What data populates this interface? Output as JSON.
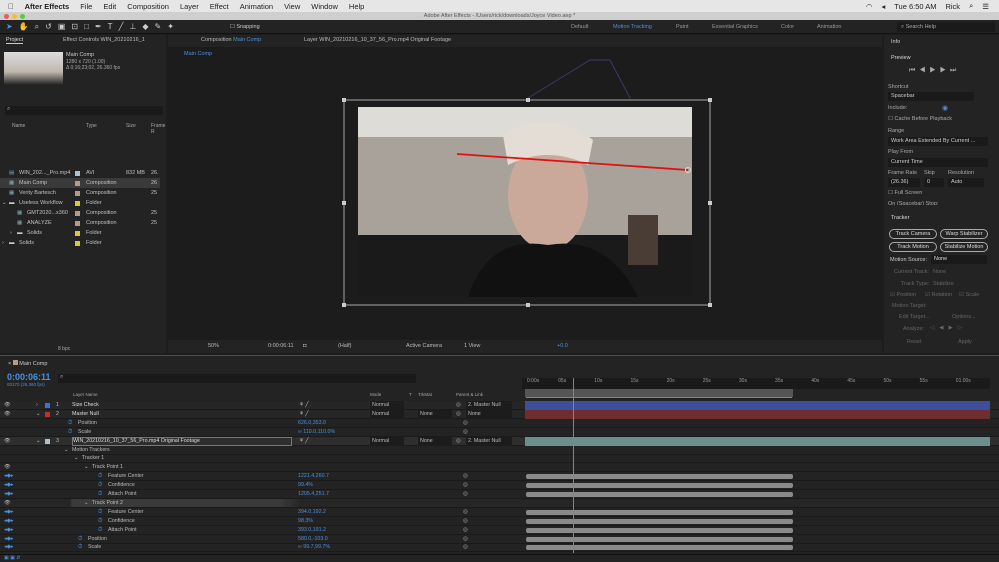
{
  "menubar": {
    "apple": "",
    "app": "After Effects",
    "items": [
      "File",
      "Edit",
      "Composition",
      "Layer",
      "Effect",
      "Animation",
      "View",
      "Window",
      "Help"
    ],
    "clock": "Tue 6:50 AM",
    "user": "Rick"
  },
  "window_title": "Adobe After Effects - /Users/rick/downloads/Joyce Video.aep *",
  "toolbar": {
    "snapping": "Snapping"
  },
  "workspaces": [
    "Default",
    "Motion Tracking",
    "Paint",
    "Essential Graphics",
    "Color",
    "Animation"
  ],
  "active_workspace": "Motion Tracking",
  "search_help": "Search Help",
  "project": {
    "tab": "Project",
    "effect_tab": "Effect Controls WIN_20210216_1",
    "comp_name": "Main Comp",
    "comp_size": "1280 x 720 (1.00)",
    "comp_dur": "Δ 0;16;23;02, 26.360 fps",
    "columns": [
      "Name",
      "Type",
      "Size",
      "Frame R"
    ],
    "items": [
      {
        "name": "WIN_202..._Pro.mp4",
        "type": "AVI",
        "size": "832 MB",
        "fr": "26.",
        "color": "#a8c4d4",
        "indent": 0,
        "icon": "file"
      },
      {
        "name": "Main Comp",
        "type": "Composition",
        "size": "",
        "fr": "26",
        "color": "#b89a86",
        "indent": 0,
        "icon": "comp",
        "selected": true
      },
      {
        "name": "Verity Bartesch",
        "type": "Composition",
        "size": "",
        "fr": "25",
        "color": "#b89a86",
        "indent": 0,
        "icon": "comp"
      },
      {
        "name": "Useless Workflow",
        "type": "Folder",
        "size": "",
        "fr": "",
        "color": "#d9c93a",
        "indent": 0,
        "icon": "folder",
        "open": true
      },
      {
        "name": "GMT2020...x360",
        "type": "Composition",
        "size": "",
        "fr": "25",
        "color": "#b89a86",
        "indent": 1,
        "icon": "comp"
      },
      {
        "name": "ANALYZE",
        "type": "Composition",
        "size": "",
        "fr": "25",
        "color": "#b89a86",
        "indent": 1,
        "icon": "comp"
      },
      {
        "name": "Solids",
        "type": "Folder",
        "size": "",
        "fr": "",
        "color": "#d9c93a",
        "indent": 1,
        "icon": "folder"
      },
      {
        "name": "Solids",
        "type": "Folder",
        "size": "",
        "fr": "",
        "color": "#d9c93a",
        "indent": 0,
        "icon": "folder"
      }
    ],
    "bpc": "8 bpc"
  },
  "comp": {
    "tab_prefix": "Composition",
    "tab_name": "Main Comp",
    "layer_tab": "Layer WIN_20210216_10_37_56_Pro.mp4 Original Footage",
    "breadcrumb": "Main Comp",
    "zoom": "50%",
    "time": "0:00:06:11",
    "resolution": "(Half)",
    "camera": "Active Camera",
    "views": "1 View",
    "exposure": "+0.0"
  },
  "info": {
    "title": "Info"
  },
  "preview": {
    "title": "Preview",
    "shortcut_label": "Shortcut",
    "shortcut": "Spacebar",
    "include": "Include:",
    "cache": "Cache Before Playback",
    "range_label": "Range",
    "range": "Work Area Extended By Current ...",
    "play_from_label": "Play From",
    "play_from": "Current Time",
    "frame_rate_label": "Frame Rate",
    "skip_label": "Skip",
    "resolution_label": "Resolution",
    "frame_rate": "(26.36)",
    "skip": "0",
    "resolution": "Auto",
    "full_screen": "Full Screen",
    "stop": "On (Spacebar) Stop:"
  },
  "tracker": {
    "title": "Tracker",
    "track_camera": "Track Camera",
    "warp": "Warp Stabilizer",
    "track_motion": "Track Motion",
    "stabilize": "Stabilize Motion",
    "motion_source_label": "Motion Source:",
    "motion_source": "None",
    "current_track_label": "Current Track:",
    "current_track": "None",
    "track_type_label": "Track Type:",
    "track_type": "Stabilize",
    "position": "Position",
    "rotation": "Rotation",
    "scale": "Scale",
    "motion_target": "Motion Target:",
    "edit_target": "Edit Target...",
    "options": "Options...",
    "analyze": "Analyze:",
    "reset": "Reset",
    "apply": "Apply"
  },
  "timeline": {
    "tab": "Main Comp",
    "timecode": "0:00:06:11",
    "frames": "00170 (26.360 fps)",
    "col_layer_name": "Layer Name",
    "col_mode": "Mode",
    "col_t": "T",
    "col_trkmat": "TrkMat",
    "col_parent": "Parent & Link",
    "ticks": [
      "0:00s",
      "05s",
      "10s",
      "15s",
      "20s",
      "25s",
      "30s",
      "35s",
      "40s",
      "45s",
      "50s",
      "55s",
      "01:00s"
    ],
    "current_time_s": 6.4,
    "work_area_end_s": 36.8,
    "rows": [
      {
        "kind": "layer",
        "num": "1",
        "name": "Size Check",
        "color": "#3a6fe0",
        "mode": "Normal",
        "trkmat": "",
        "parent": "2. Master Null",
        "bar": "#3b4f9a",
        "vis": true
      },
      {
        "kind": "layer",
        "num": "2",
        "name": "Master Null",
        "color": "#c03030",
        "mode": "Normal",
        "trkmat": "None",
        "parent": "None",
        "bar": "#6e2e30",
        "vis": true
      },
      {
        "kind": "prop",
        "indent": 1,
        "name": "Position",
        "value": "626.0,353.0"
      },
      {
        "kind": "prop",
        "indent": 1,
        "name": "Scale",
        "value": "∞ 110.0,110.0%"
      },
      {
        "kind": "layer",
        "num": "3",
        "name": "WIN_20210216_10_37_56_Pro.mp4 Original Footage",
        "color": "#a8c4d4",
        "mode": "Normal",
        "trkmat": "None",
        "parent": "2. Master Null",
        "bar": "#6c8f8e",
        "vis": true,
        "selected": true
      },
      {
        "kind": "group",
        "indent": 1,
        "name": "Motion Trackers"
      },
      {
        "kind": "group",
        "indent": 2,
        "name": "Tracker 1"
      },
      {
        "kind": "group",
        "indent": 3,
        "name": "Track Point 1"
      },
      {
        "kind": "prop",
        "indent": 4,
        "name": "Feature Center",
        "value": "1221.4,260.7",
        "keys": true
      },
      {
        "kind": "prop",
        "indent": 4,
        "name": "Confidence",
        "value": "99.4%",
        "keys": true
      },
      {
        "kind": "prop",
        "indent": 4,
        "name": "Attach Point",
        "value": "1205.4,251.7",
        "keys": true
      },
      {
        "kind": "group",
        "indent": 3,
        "name": "Track Point 2",
        "hl": true
      },
      {
        "kind": "prop",
        "indent": 4,
        "name": "Feature Center",
        "value": "394.0,192.2",
        "keys": true
      },
      {
        "kind": "prop",
        "indent": 4,
        "name": "Confidence",
        "value": "98.3%",
        "keys": true
      },
      {
        "kind": "prop",
        "indent": 4,
        "name": "Attach Point",
        "value": "393.0,191.2",
        "keys": true
      },
      {
        "kind": "prop",
        "indent": 2,
        "name": "Position",
        "value": "580.0,-103.0",
        "keys": true
      },
      {
        "kind": "prop",
        "indent": 2,
        "name": "Scale",
        "value": "∞ 99.7,99.7%",
        "keys": true
      }
    ]
  }
}
